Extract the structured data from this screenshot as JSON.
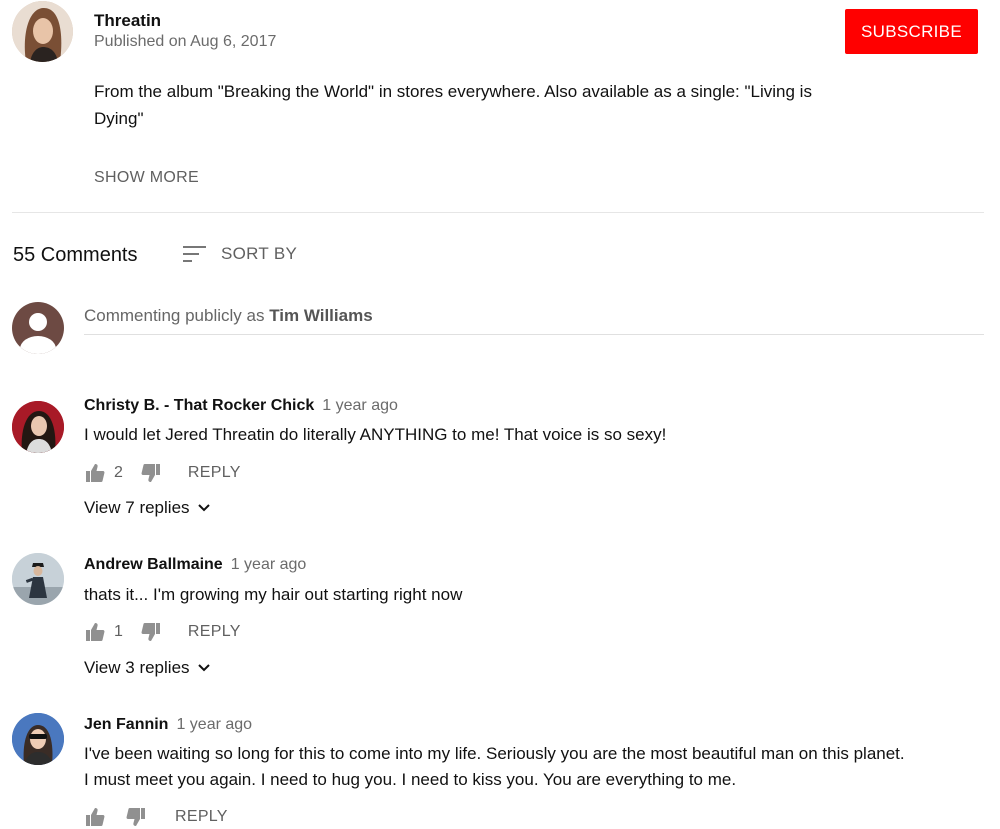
{
  "channel": {
    "name": "Threatin",
    "published": "Published on Aug 6, 2017",
    "subscribe_label": "SUBSCRIBE"
  },
  "description": {
    "text": "From the album \"Breaking the World\" in stores everywhere. Also available as a single: \"Living is Dying\"",
    "show_more_label": "SHOW MORE"
  },
  "comments_header": {
    "count_label": "55 Comments",
    "sort_label": "SORT BY"
  },
  "comment_box": {
    "prefix": "Commenting publicly as ",
    "user": "Tim Williams"
  },
  "comments": [
    {
      "author": "Christy B. - That Rocker Chick",
      "time": "1 year ago",
      "text": "I would let Jered Threatin do literally ANYTHING to me! That voice is so sexy!",
      "likes": "2",
      "reply_label": "REPLY",
      "view_replies": "View 7 replies"
    },
    {
      "author": "Andrew Ballmaine",
      "time": "1 year ago",
      "text": "thats it... I'm growing my hair out starting right now",
      "likes": "1",
      "reply_label": "REPLY",
      "view_replies": "View 3 replies"
    },
    {
      "author": "Jen Fannin",
      "time": "1 year ago",
      "text": "I've been waiting so long for this to come into my life. Seriously you are the most beautiful man on this planet. I must meet you again. I need to hug you. I need to kiss you. You are everything to me.",
      "likes": "",
      "reply_label": "REPLY"
    }
  ],
  "colors": {
    "subscribe": "#ff0000",
    "muted_text": "#606060",
    "divider": "#e6e6e6"
  },
  "icons": [
    "thumb-up-icon",
    "thumb-down-icon",
    "sort-icon",
    "chevron-down-icon",
    "default-avatar-icon"
  ]
}
